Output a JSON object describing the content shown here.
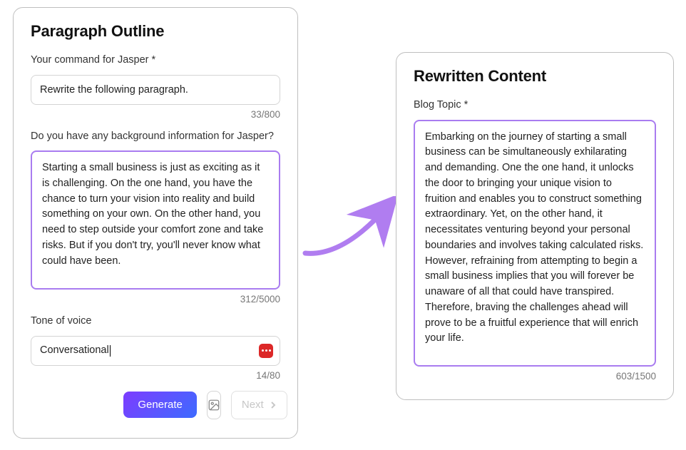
{
  "left": {
    "title": "Paragraph Outline",
    "command_label": "Your command for Jasper *",
    "command_value": "Rewrite the following paragraph.",
    "command_counter": "33/800",
    "background_label": "Do you have any background information for Jasper?",
    "background_value": "Starting a small business is just as exciting as it is challenging. On the one hand, you have the chance to turn your vision into reality and build something on your own. On the other hand, you need to step outside your comfort zone and take risks. But if you don't try, you'll never know what could have been.",
    "background_counter": "312/5000",
    "tone_label": "Tone of voice",
    "tone_value": "Conversational",
    "tone_counter": "14/80",
    "generate_label": "Generate",
    "next_label": "Next"
  },
  "right": {
    "title": "Rewritten Content",
    "topic_label": "Blog Topic *",
    "topic_value": "Embarking on the journey of starting a small business can be simultaneously exhilarating and demanding. One the one hand, it unlocks the door to bringing your unique vision to fruition and enables you to construct something extraordinary. Yet, on the other hand, it necessitates venturing beyond your personal boundaries and involves taking calculated risks. However, refraining from attempting to begin a small business implies that you will forever be unaware of all that could have transpired. Therefore, braving the challenges ahead will prove to be a fruitful experience that will enrich your life.",
    "topic_counter": "603/1500"
  }
}
